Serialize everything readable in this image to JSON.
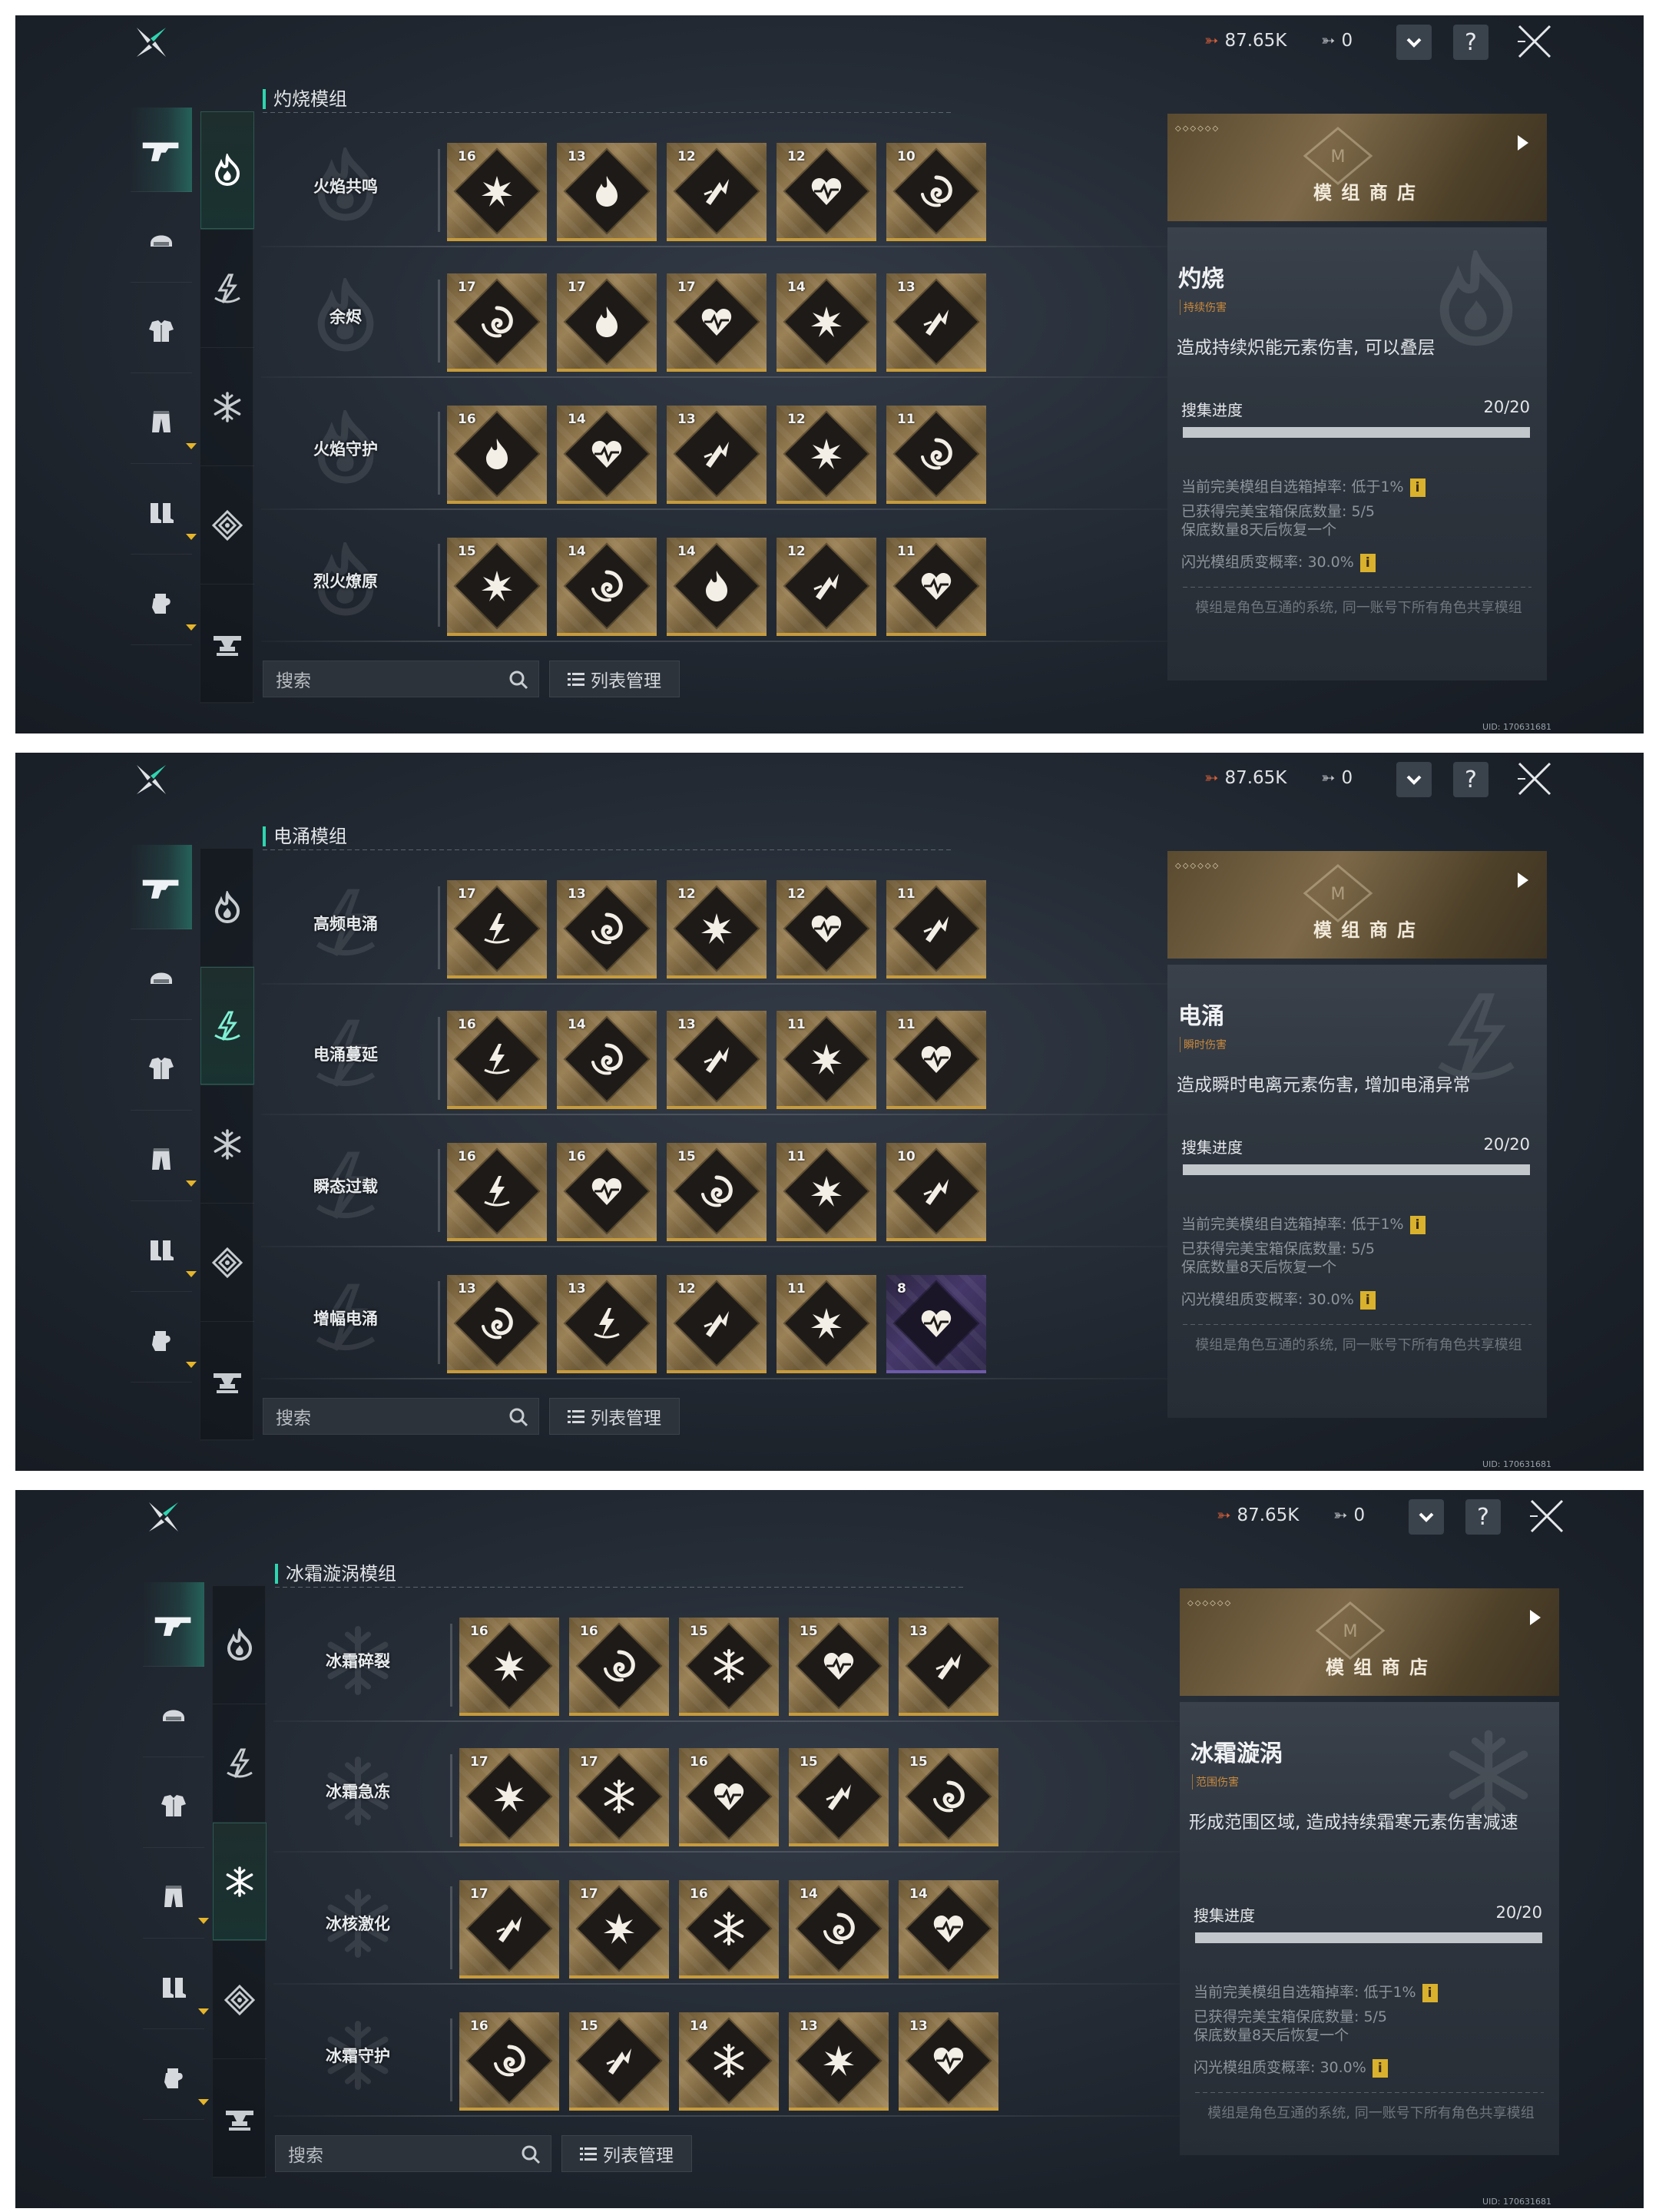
{
  "topbar": {
    "currency_a": "87.65K",
    "currency_b": "0",
    "help": "?"
  },
  "controls": {
    "search_placeholder": "搜索",
    "list_manage": "列表管理"
  },
  "shop": {
    "label": "模 组 商 店",
    "stars": "◇◇◇◇◇◇"
  },
  "info_common": {
    "progress_label": "搜集进度",
    "progress_value": "20/20",
    "progress_fraction": 1.0,
    "drop_rate": "当前完美模组自选箱掉率: 低于1%",
    "pity_count": "已获得完美宝箱保底数量: 5/5",
    "pity_restore": "保底数量8天后恢复一个",
    "flash_rate": "闪光模组质变概率: 30.0%",
    "info_badge": "i",
    "footer": "模组是角色互通的系统, 同一账号下所有角色共享模组",
    "uid": "UID: 170631681"
  },
  "panels": [
    {
      "section_title": "灼烧模组",
      "active_element": 0,
      "info": {
        "name": "灼烧",
        "tag": "持续伤害",
        "desc": "造成持续炽能元素伤害, 可以叠层"
      },
      "rows": [
        {
          "name": "火焰共鸣",
          "tiles": [
            {
              "lvl": "16",
              "icon": "burst-icon"
            },
            {
              "lvl": "13",
              "icon": "flame-icon"
            },
            {
              "lvl": "12",
              "icon": "strike-icon"
            },
            {
              "lvl": "12",
              "icon": "heart-icon"
            },
            {
              "lvl": "10",
              "icon": "swirl-icon"
            }
          ]
        },
        {
          "name": "余烬",
          "tiles": [
            {
              "lvl": "17",
              "icon": "swirl-icon"
            },
            {
              "lvl": "17",
              "icon": "flame-icon"
            },
            {
              "lvl": "17",
              "icon": "heart-icon"
            },
            {
              "lvl": "14",
              "icon": "burst-icon"
            },
            {
              "lvl": "13",
              "icon": "strike-icon"
            }
          ]
        },
        {
          "name": "火焰守护",
          "tiles": [
            {
              "lvl": "16",
              "icon": "flame-icon"
            },
            {
              "lvl": "14",
              "icon": "heart-icon"
            },
            {
              "lvl": "13",
              "icon": "strike-icon"
            },
            {
              "lvl": "12",
              "icon": "burst-icon"
            },
            {
              "lvl": "11",
              "icon": "swirl-icon"
            }
          ]
        },
        {
          "name": "烈火燎原",
          "tiles": [
            {
              "lvl": "15",
              "icon": "burst-icon"
            },
            {
              "lvl": "14",
              "icon": "swirl-icon"
            },
            {
              "lvl": "14",
              "icon": "flame-icon"
            },
            {
              "lvl": "12",
              "icon": "strike-icon"
            },
            {
              "lvl": "11",
              "icon": "heart-icon"
            }
          ]
        }
      ]
    },
    {
      "section_title": "电涌模组",
      "active_element": 1,
      "info": {
        "name": "电涌",
        "tag": "瞬时伤害",
        "desc": "造成瞬时电离元素伤害, 增加电涌异常"
      },
      "rows": [
        {
          "name": "高频电涌",
          "tiles": [
            {
              "lvl": "17",
              "icon": "bolt-icon"
            },
            {
              "lvl": "13",
              "icon": "swirl-icon"
            },
            {
              "lvl": "12",
              "icon": "burst-icon"
            },
            {
              "lvl": "12",
              "icon": "heart-icon"
            },
            {
              "lvl": "11",
              "icon": "strike-icon"
            }
          ]
        },
        {
          "name": "电涌蔓延",
          "tiles": [
            {
              "lvl": "16",
              "icon": "bolt-icon"
            },
            {
              "lvl": "14",
              "icon": "swirl-icon"
            },
            {
              "lvl": "13",
              "icon": "strike-icon"
            },
            {
              "lvl": "11",
              "icon": "burst-icon"
            },
            {
              "lvl": "11",
              "icon": "heart-icon"
            }
          ]
        },
        {
          "name": "瞬态过载",
          "tiles": [
            {
              "lvl": "16",
              "icon": "bolt-icon"
            },
            {
              "lvl": "16",
              "icon": "heart-icon"
            },
            {
              "lvl": "15",
              "icon": "swirl-icon"
            },
            {
              "lvl": "11",
              "icon": "burst-icon"
            },
            {
              "lvl": "10",
              "icon": "strike-icon"
            }
          ]
        },
        {
          "name": "增幅电涌",
          "tiles": [
            {
              "lvl": "13",
              "icon": "swirl-icon"
            },
            {
              "lvl": "13",
              "icon": "bolt-icon"
            },
            {
              "lvl": "12",
              "icon": "strike-icon"
            },
            {
              "lvl": "11",
              "icon": "burst-icon"
            },
            {
              "lvl": "8",
              "icon": "heart-icon",
              "rarity": "purple"
            }
          ]
        }
      ]
    },
    {
      "section_title": "冰霜漩涡模组",
      "active_element": 2,
      "info": {
        "name": "冰霜漩涡",
        "tag": "范围伤害",
        "desc": "形成范围区域, 造成持续霜寒元素伤害减速"
      },
      "rows": [
        {
          "name": "冰霜碎裂",
          "tiles": [
            {
              "lvl": "16",
              "icon": "burst-icon"
            },
            {
              "lvl": "16",
              "icon": "swirl-icon"
            },
            {
              "lvl": "15",
              "icon": "snowflake-icon"
            },
            {
              "lvl": "15",
              "icon": "heart-icon"
            },
            {
              "lvl": "13",
              "icon": "strike-icon"
            }
          ]
        },
        {
          "name": "冰霜急冻",
          "tiles": [
            {
              "lvl": "17",
              "icon": "burst-icon"
            },
            {
              "lvl": "17",
              "icon": "snowflake-icon"
            },
            {
              "lvl": "16",
              "icon": "heart-icon"
            },
            {
              "lvl": "15",
              "icon": "strike-icon"
            },
            {
              "lvl": "15",
              "icon": "swirl-icon"
            }
          ]
        },
        {
          "name": "冰核激化",
          "tiles": [
            {
              "lvl": "17",
              "icon": "strike-icon"
            },
            {
              "lvl": "17",
              "icon": "burst-icon"
            },
            {
              "lvl": "16",
              "icon": "snowflake-icon"
            },
            {
              "lvl": "14",
              "icon": "swirl-icon"
            },
            {
              "lvl": "14",
              "icon": "heart-icon"
            }
          ]
        },
        {
          "name": "冰霜守护",
          "tiles": [
            {
              "lvl": "16",
              "icon": "swirl-icon"
            },
            {
              "lvl": "15",
              "icon": "strike-icon"
            },
            {
              "lvl": "14",
              "icon": "snowflake-icon"
            },
            {
              "lvl": "13",
              "icon": "burst-icon"
            },
            {
              "lvl": "13",
              "icon": "heart-icon"
            }
          ]
        }
      ]
    }
  ],
  "sidebar": {
    "equipment": [
      {
        "icon": "pistol-icon"
      },
      {
        "icon": "helmet-icon"
      },
      {
        "icon": "armor-icon"
      },
      {
        "icon": "pants-icon",
        "mark": true
      },
      {
        "icon": "boots-icon",
        "mark": true
      },
      {
        "icon": "glove-icon",
        "mark": true
      }
    ],
    "elements": [
      {
        "icon": "fire-element-icon"
      },
      {
        "icon": "thunder-element-icon"
      },
      {
        "icon": "frost-element-icon"
      },
      {
        "icon": "physical-element-icon"
      },
      {
        "icon": "anvil-icon"
      }
    ]
  },
  "colors": {
    "accent": "#2fd5b0",
    "gold": "#c79b3c",
    "purple": "#6d5aa8",
    "info_badge": "#d9b12d"
  }
}
